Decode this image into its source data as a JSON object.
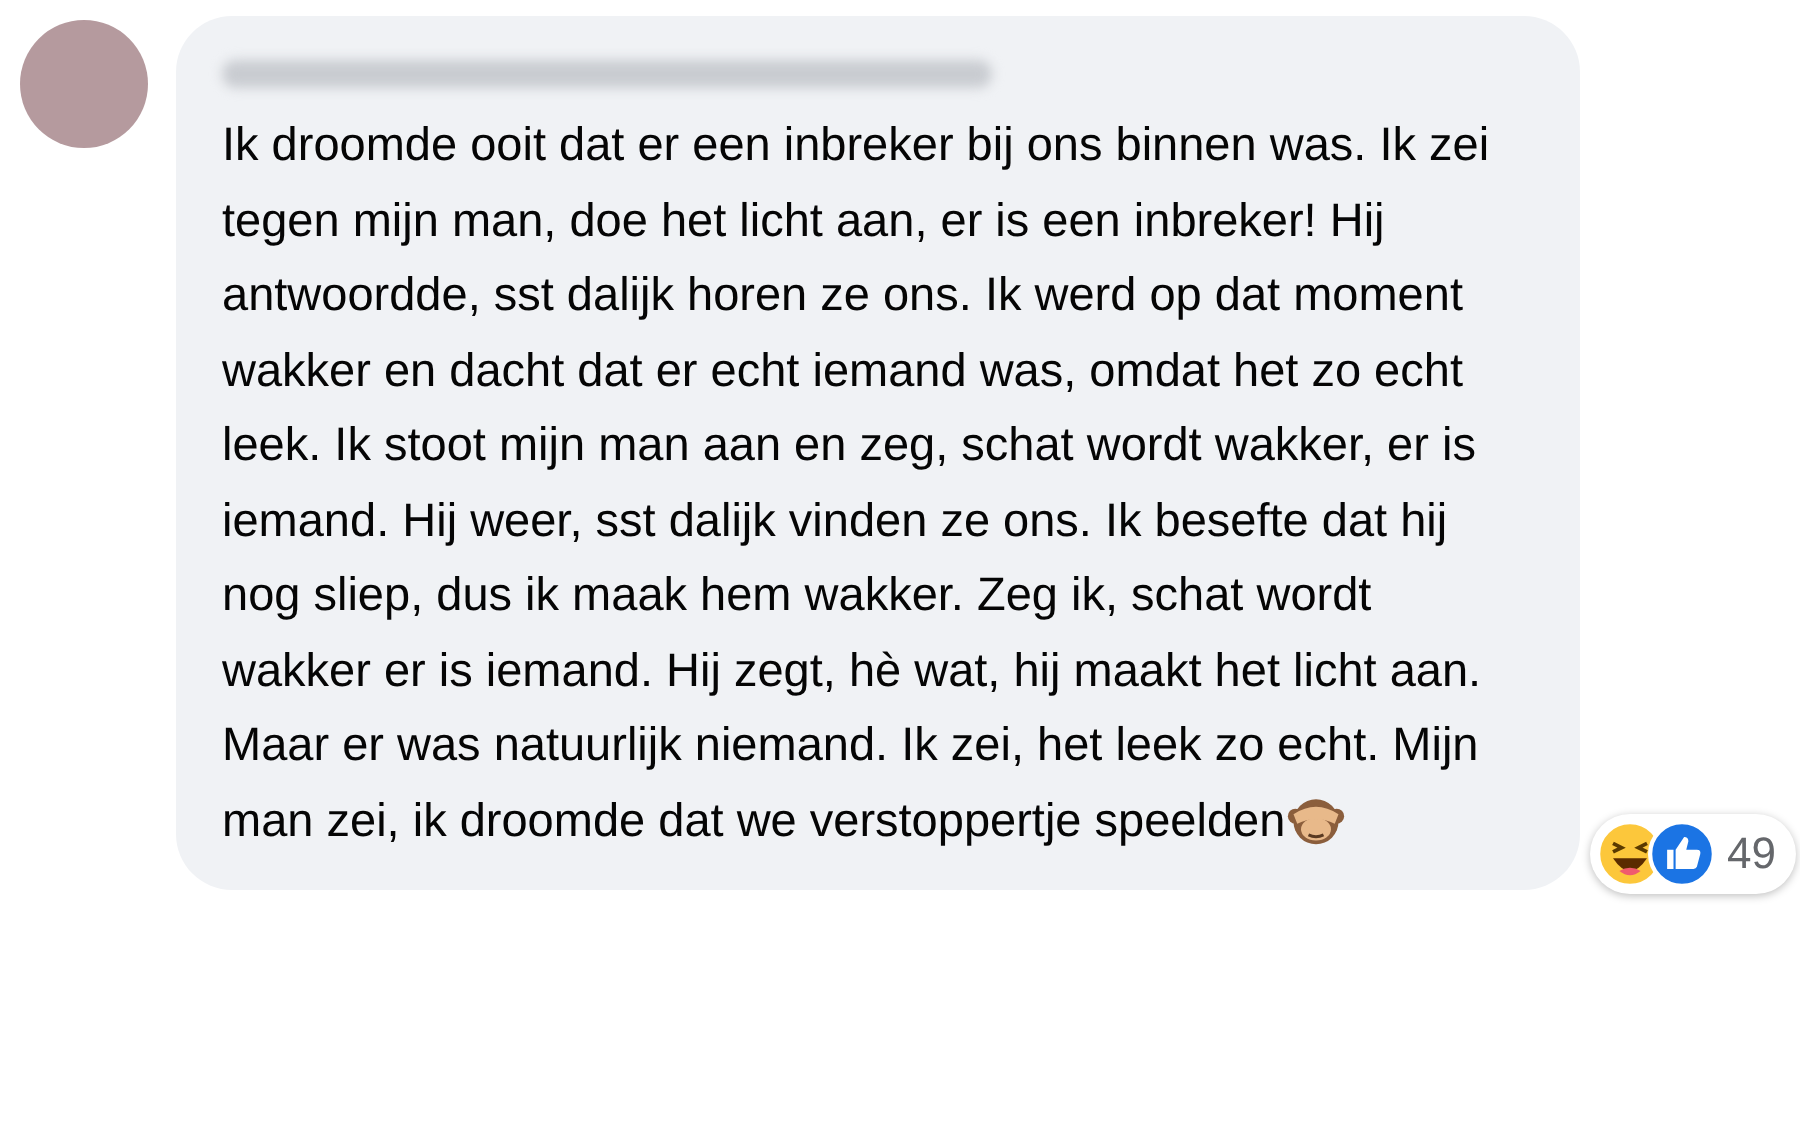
{
  "comment": {
    "text": "Ik droomde ooit dat er een inbreker bij ons binnen was. Ik zei tegen mijn man, doe het licht aan, er is een inbreker! Hij antwoordde, sst dalijk horen ze ons. Ik werd op dat moment wakker en dacht dat er echt iemand was, omdat het zo echt leek. Ik stoot mijn man aan en zeg, schat wordt wakker, er is iemand. Hij weer, sst dalijk vinden ze ons. Ik besefte dat hij nog sliep, dus ik maak hem wakker. Zeg ik, schat wordt wakker er is iemand. Hij zegt, hè wat, hij maakt het licht aan. Maar er was natuurlijk niemand. Ik zei, het leek zo echt. Mijn man zei, ik droomde dat we verstoppertje speelden",
    "reactions": {
      "count": "49"
    }
  }
}
